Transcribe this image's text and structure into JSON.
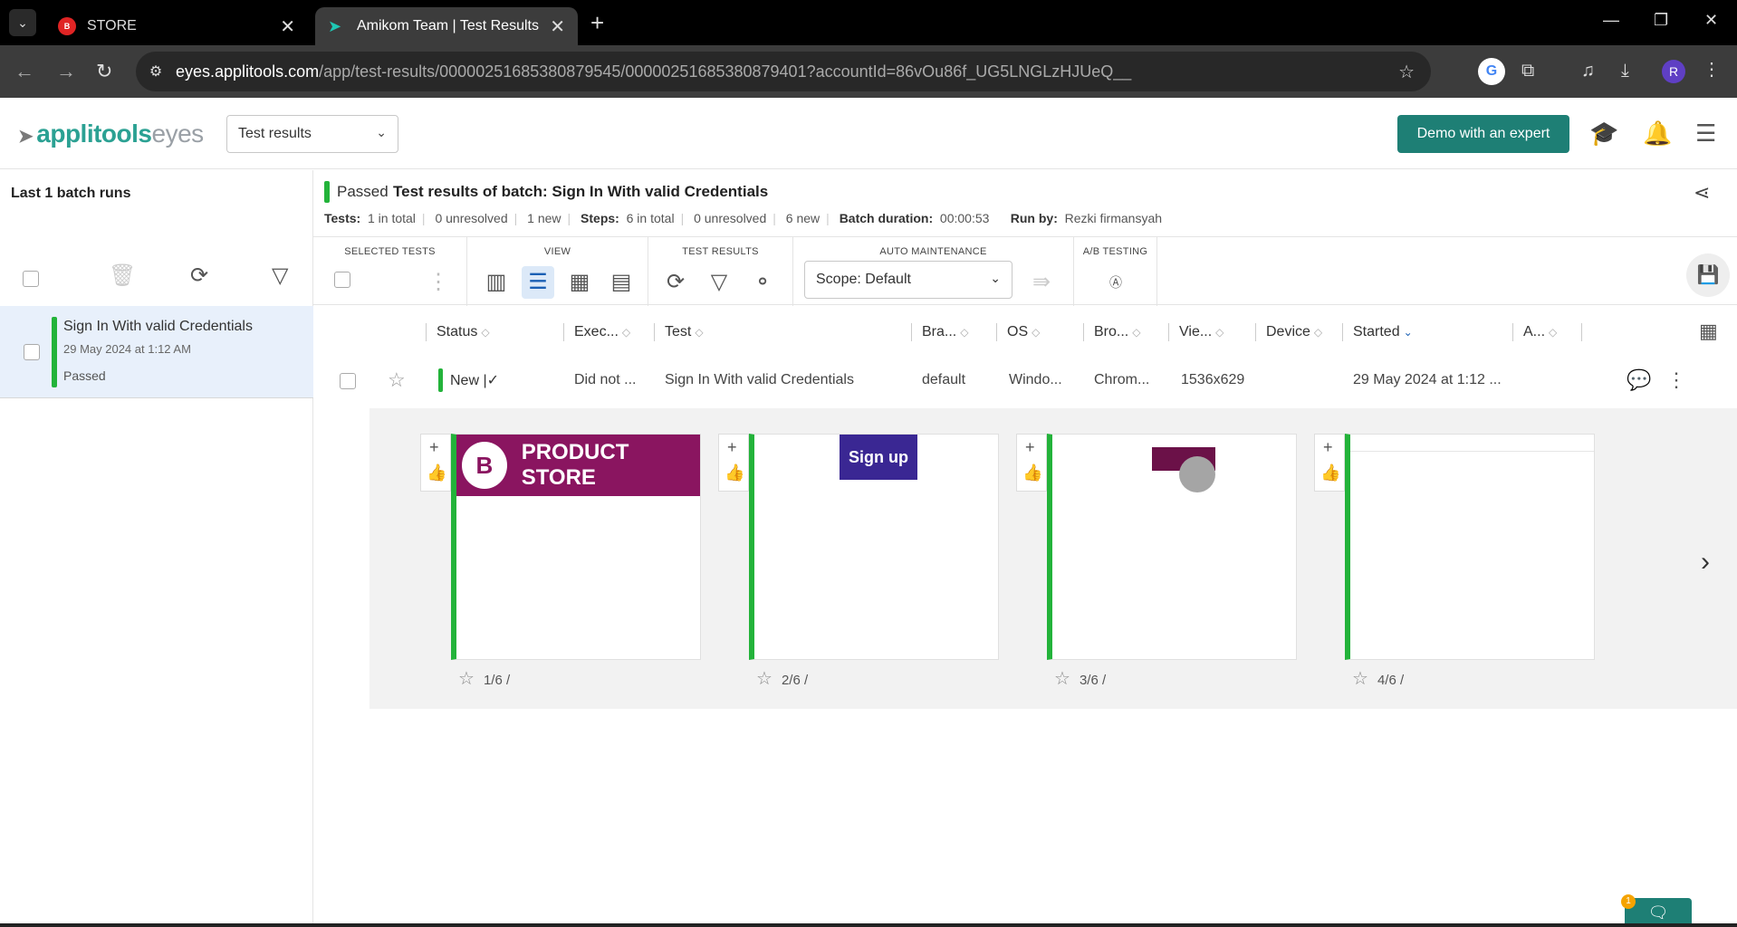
{
  "browser": {
    "tabs": [
      {
        "title": "STORE",
        "favicon": "store-favicon"
      },
      {
        "title": "Amikom Team | Test Results | Ap",
        "favicon": "applitools-favicon",
        "active": true
      }
    ],
    "url_host": "eyes.applitools.com",
    "url_rest": "/app/test-results/00000251685380879545/00000251685380879401?accountId=86vOu86f_UG5LNGLzHJUeQ__",
    "profile_initial": "R"
  },
  "header": {
    "logo_primary": "applitools",
    "logo_secondary": "eyes",
    "view_select": "Test results",
    "demo_button": "Demo with an expert"
  },
  "sidebar": {
    "title": "Last 1 batch runs",
    "batch": {
      "name": "Sign In With valid Credentials",
      "date": "29 May 2024 at 1:12 AM",
      "status": "Passed"
    }
  },
  "summary": {
    "status": "Passed",
    "title": "Test results of batch:  Sign In With valid Credentials",
    "tests_label": "Tests:",
    "tests_total": "1 in total",
    "tests_unresolved": "0 unresolved",
    "tests_new": "1 new",
    "steps_label": "Steps:",
    "steps_total": "6 in total",
    "steps_unresolved": "0 unresolved",
    "steps_new": "6 new",
    "duration_label": "Batch duration:",
    "duration": "00:00:53",
    "runby_label": "Run by:",
    "runby": "Rezki firmansyah"
  },
  "toolbar": {
    "selected_tests": "SELECTED TESTS",
    "view": "VIEW",
    "test_results": "TEST RESULTS",
    "auto_maintenance": "AUTO MAINTENANCE",
    "scope": "Scope: Default",
    "ab_testing": "A/B TESTING"
  },
  "table": {
    "columns": [
      "Status",
      "Exec...",
      "Test",
      "Bra...",
      "OS",
      "Bro...",
      "Vie...",
      "Device",
      "Started",
      "A..."
    ],
    "row": {
      "status": "New |✓",
      "exec": "Did not ...",
      "test": "Sign In With valid Credentials",
      "branch": "default",
      "os": "Windo...",
      "browser": "Chrom...",
      "viewport": "1536x629",
      "device": "",
      "started": "29 May 2024 at 1:12 ..."
    }
  },
  "thumbnails": [
    {
      "caption": "1/6 /",
      "image_text": "PRODUCT STORE"
    },
    {
      "caption": "2/6 /",
      "image_text": "Sign up"
    },
    {
      "caption": "3/6 /",
      "image_text": ""
    },
    {
      "caption": "4/6 /",
      "image_text": ""
    }
  ],
  "chat": {
    "badge": "1"
  },
  "colors": {
    "accent": "#1e7f75",
    "passed": "#23b33a",
    "brand_teal": "#2ba193"
  }
}
